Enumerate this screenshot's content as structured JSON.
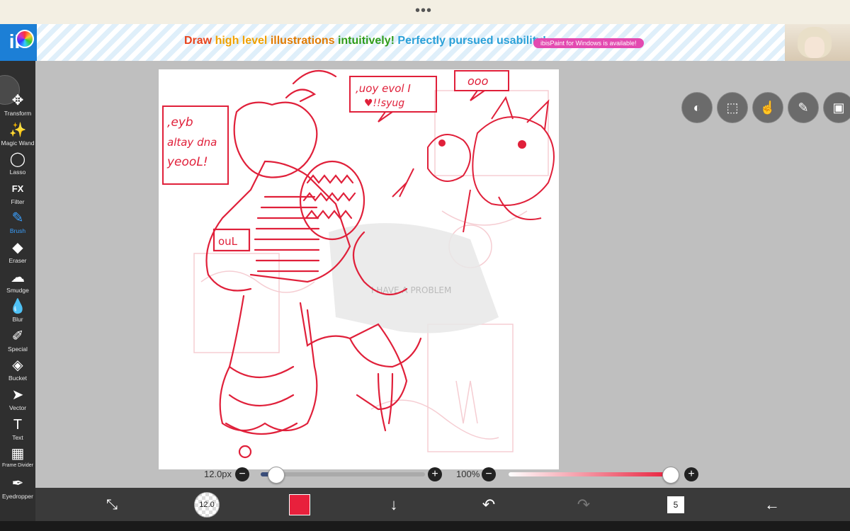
{
  "topbar": {
    "menu_dots": "•••"
  },
  "banner": {
    "logo_text": "iP",
    "slogan_parts": [
      "Draw ",
      "high level ",
      "illustrations ",
      "intuitively! ",
      "Perfectly pursued usability!"
    ],
    "pill": "ibisPaint for Windows is available!"
  },
  "tools": [
    {
      "label": "Transform",
      "icon": "move-icon",
      "glyph": "✥"
    },
    {
      "label": "Magic Wand",
      "icon": "magic-wand-icon",
      "glyph": "✨"
    },
    {
      "label": "Lasso",
      "icon": "lasso-icon",
      "glyph": "◯"
    },
    {
      "label": "Filter",
      "icon": "fx-icon",
      "glyph": "FX"
    },
    {
      "label": "Brush",
      "icon": "brush-icon",
      "glyph": "✎",
      "active": true
    },
    {
      "label": "Eraser",
      "icon": "eraser-icon",
      "glyph": "◆"
    },
    {
      "label": "Smudge",
      "icon": "smudge-icon",
      "glyph": "☁"
    },
    {
      "label": "Blur",
      "icon": "blur-icon",
      "glyph": "💧"
    },
    {
      "label": "Special",
      "icon": "special-pen-icon",
      "glyph": "✐"
    },
    {
      "label": "Bucket",
      "icon": "bucket-icon",
      "glyph": "◈"
    },
    {
      "label": "Vector",
      "icon": "vector-cursor-icon",
      "glyph": "➤"
    },
    {
      "label": "Text",
      "icon": "text-icon",
      "glyph": "T"
    },
    {
      "label": "Frame Divider",
      "icon": "frame-divider-icon",
      "glyph": "▦"
    },
    {
      "label": "Eyedropper",
      "icon": "eyedropper-icon",
      "glyph": "✒"
    }
  ],
  "brush_size": {
    "value_label": "12.0px",
    "level": 0.06
  },
  "opacity": {
    "value_label": "100%",
    "level": 1.0
  },
  "bottom": {
    "brush_badge": "12.0",
    "current_color": "#e8203c",
    "layer_count": "5"
  },
  "colors": {
    "ink": "#e0203a",
    "accent": "#3aa0ff"
  },
  "canvas_text": {
    "bubble_left": [
      ",eyb",
      "altay dna",
      "yeooL!"
    ],
    "bubble_mid": [
      ",uoy evol I",
      "♥!!syug"
    ],
    "bubble_right": "ooo",
    "ghost_shirt": "I HAVE A PROBLEM",
    "badge": "ouL"
  }
}
